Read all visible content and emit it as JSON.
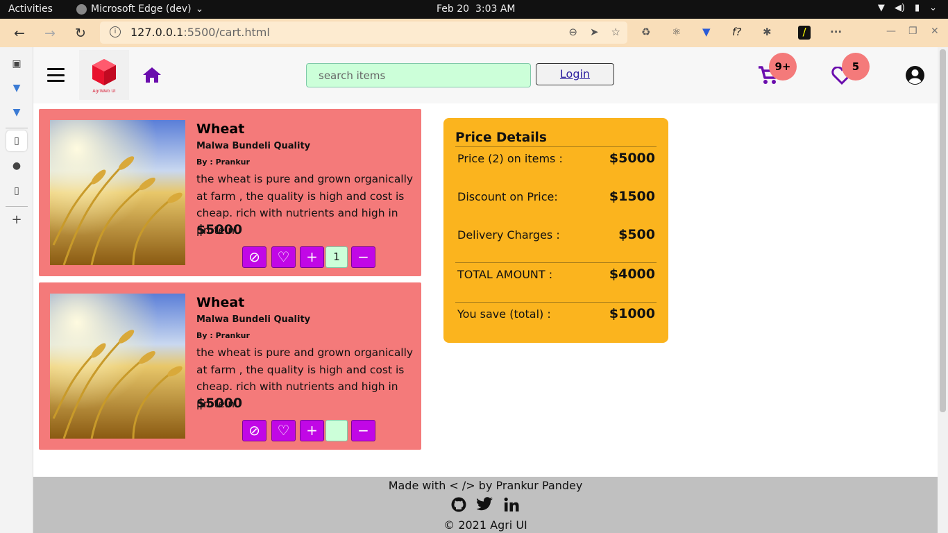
{
  "system_bar": {
    "activities": "Activities",
    "app_name": "Microsoft Edge (dev)",
    "date": "Feb 20",
    "time": "3:03 AM"
  },
  "browser": {
    "url_host": "127.0.0.1",
    "url_path": ":5500/cart.html"
  },
  "header": {
    "search_placeholder": "search items",
    "login_label": "Login",
    "logo_text": "AgriWeb UI",
    "cart_badge": "9+",
    "wishlist_badge": "5"
  },
  "cart_items": [
    {
      "name": "Wheat",
      "quality": "Malwa Bundeli Quality",
      "by": "By : Prankur",
      "description": "the wheat is pure and grown organically at farm , the quality is high and cost is cheap. rich with nutrients and high in protein.",
      "price": "$5000",
      "quantity": "1"
    },
    {
      "name": "Wheat",
      "quality": "Malwa Bundeli Quality",
      "by": "By : Prankur",
      "description": "the wheat is pure and grown organically at farm , the quality is high and cost is cheap. rich with nutrients and high in protein.",
      "price": "$5000",
      "quantity": ""
    }
  ],
  "price_details": {
    "title": "Price Details",
    "price_label": "Price (2) on items :",
    "price_value": "$5000",
    "discount_label": "Discount on Price:",
    "discount_value": "$1500",
    "delivery_label": "Delivery Charges :",
    "delivery_value": "$500",
    "total_label": "TOTAL AMOUNT :",
    "total_value": "$4000",
    "save_label": "You save (total) :",
    "save_value": "$1000"
  },
  "footer": {
    "made_with": "Made with < /> by Prankur Pandey",
    "copyright": "© 2021 Agri UI"
  },
  "colors": {
    "card_bg": "#f47a7a",
    "button_purple": "#c107e6",
    "price_panel": "#fbb41e",
    "icon_purple": "#6a0dad",
    "footer_bg": "#c0c0c0"
  }
}
